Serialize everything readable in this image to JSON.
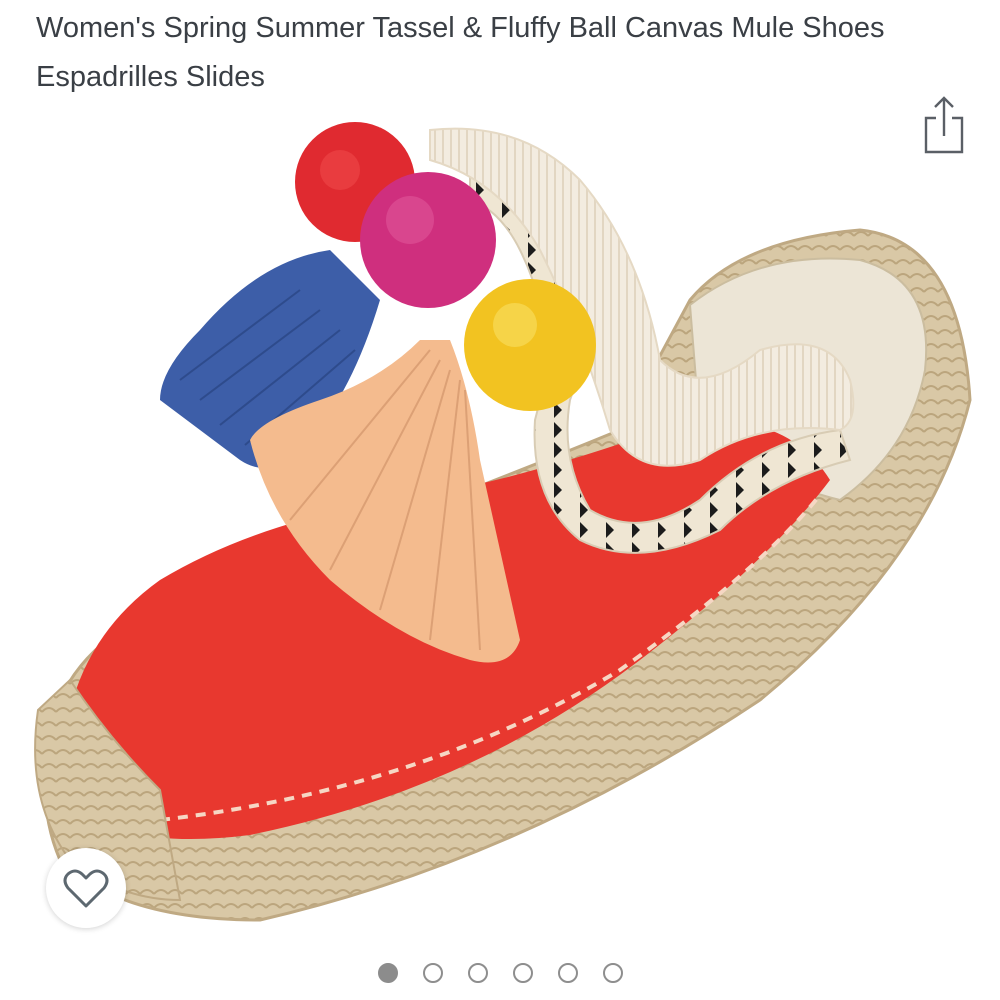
{
  "product": {
    "title": "Women's Spring Summer Tassel & Fluffy Ball Canvas Mule Shoes Espadrilles Slides"
  },
  "icons": {
    "share": "share-icon",
    "favorite": "heart-outline-icon"
  },
  "gallery": {
    "image_count": 6,
    "active_index": 0
  },
  "colors": {
    "title_text": "#3a3f45",
    "dot_active": "#8c8c8c",
    "dot_border": "#8e8e8e",
    "shoe_red": "#e8382f",
    "jute": "#d9c7a4"
  }
}
